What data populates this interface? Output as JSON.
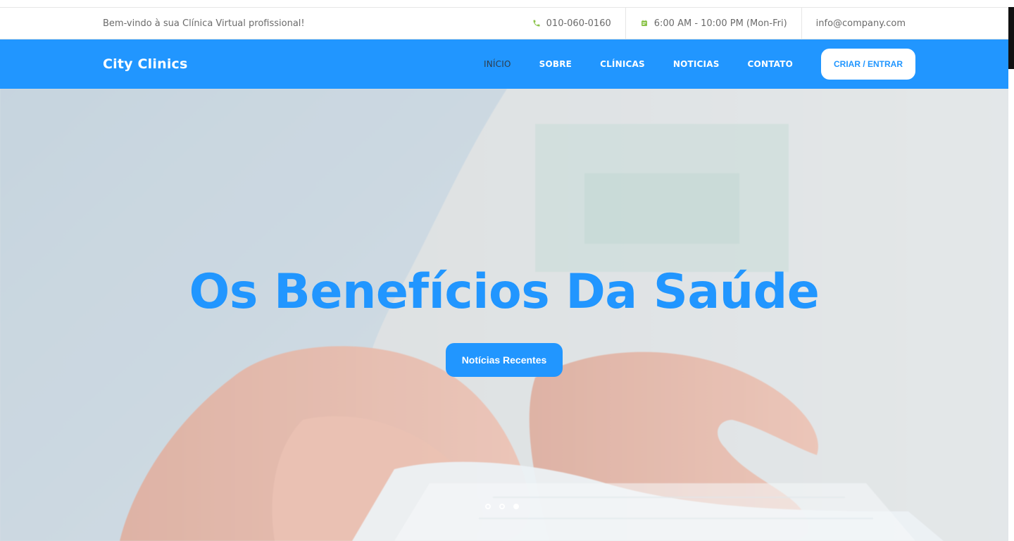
{
  "topbar": {
    "welcome": "Bem-vindo à sua Clínica Virtual profissional!",
    "phone": "010-060-0160",
    "hours": "6:00 AM - 10:00 PM (Mon-Fri)",
    "email": "info@company.com",
    "icons": {
      "phone": "phone-icon",
      "calendar": "calendar-icon"
    },
    "accent_color": "#8bc34a"
  },
  "navbar": {
    "brand": "City Clinics",
    "menu": [
      {
        "label": "INÍCIO",
        "active": true
      },
      {
        "label": "SOBRE",
        "active": false
      },
      {
        "label": "CLÍNICAS",
        "active": false
      },
      {
        "label": "NOTICIAS",
        "active": false
      },
      {
        "label": "CONTATO",
        "active": false
      }
    ],
    "cta_label": "CRIAR / ENTRAR",
    "background_color": "#2196ff"
  },
  "hero": {
    "title": "Os Benefícios Da Saúde",
    "button_label": "Notícias Recentes",
    "slides_count": 3,
    "active_slide": 3,
    "title_color": "#2196ff"
  }
}
